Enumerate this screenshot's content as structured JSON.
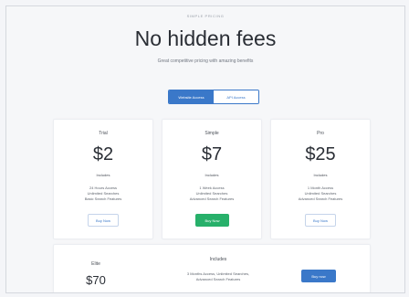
{
  "header": {
    "eyebrow": "SIMPLE PRICING",
    "title": "No hidden fees",
    "subtitle": "Great competitive pricing with amazing benefits"
  },
  "toggle": {
    "options": [
      {
        "label": "Website Access",
        "active": true
      },
      {
        "label": "API Access",
        "active": false
      }
    ]
  },
  "plans": [
    {
      "name": "Trial",
      "price": "$2",
      "includes_label": "Includes",
      "features": [
        "24 Hours Access",
        "Unlimited Searches",
        "Basic Search Features"
      ],
      "button": "Buy Now",
      "button_style": "outline"
    },
    {
      "name": "Simple",
      "price": "$7",
      "includes_label": "Includes",
      "features": [
        "1 Week Access",
        "Unlimited Searches",
        "Advanced Search Features"
      ],
      "button": "Buy Now",
      "button_style": "green"
    },
    {
      "name": "Pro",
      "price": "$25",
      "includes_label": "Includes",
      "features": [
        "1 Month Access",
        "Unlimited Searches",
        "Advanced Search Features"
      ],
      "button": "Buy Now",
      "button_style": "outline"
    }
  ],
  "wide_plan": {
    "name": "Elite",
    "price": "$70",
    "includes_label": "Includes",
    "features": [
      "3 Months Access, Unlimited Searches,",
      "Advanced Search Features"
    ],
    "button": "Buy now"
  },
  "colors": {
    "accent": "#3a78c9",
    "green": "#27b06a",
    "background": "#f6f7f9"
  }
}
